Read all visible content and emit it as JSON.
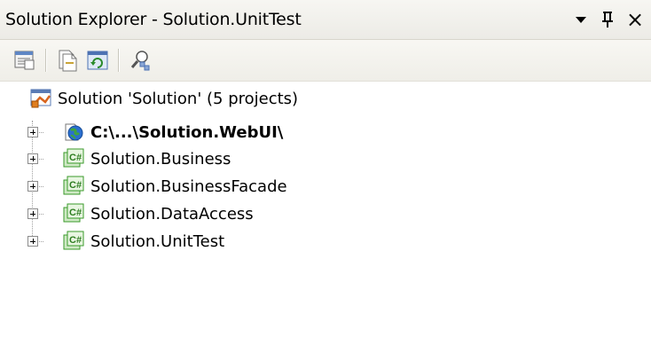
{
  "window": {
    "title": "Solution Explorer - Solution.UnitTest",
    "controls": {
      "dropdown_icon": "chevron-down-icon",
      "pin_glyph": "ф",
      "pin_icon": "pin-icon",
      "close_glyph": "×",
      "close_icon": "close-icon"
    }
  },
  "toolbar": {
    "buttons": [
      {
        "icon": "properties-icon"
      },
      {
        "icon": "show-all-files-icon"
      },
      {
        "icon": "refresh-icon"
      },
      {
        "icon": "class-view-icon"
      }
    ]
  },
  "tree": {
    "root": {
      "label": "Solution 'Solution' (5 projects)",
      "icon": "solution-icon"
    },
    "projects": [
      {
        "label": "C:\\...\\Solution.WebUI\\",
        "icon": "website-globe-icon",
        "bold": true,
        "expanded": false
      },
      {
        "label": "Solution.Business",
        "icon": "csharp-project-icon",
        "bold": false,
        "expanded": false
      },
      {
        "label": "Solution.BusinessFacade",
        "icon": "csharp-project-icon",
        "bold": false,
        "expanded": false
      },
      {
        "label": "Solution.DataAccess",
        "icon": "csharp-project-icon",
        "bold": false,
        "expanded": false
      },
      {
        "label": "Solution.UnitTest",
        "icon": "csharp-project-icon",
        "bold": false,
        "expanded": false
      }
    ]
  },
  "colors": {
    "title_bg": "#ecebe6",
    "toolbar_bg": "#efeee8",
    "csharp_icon_green": "#3a9a2a",
    "globe_blue": "#2a6fcf"
  }
}
